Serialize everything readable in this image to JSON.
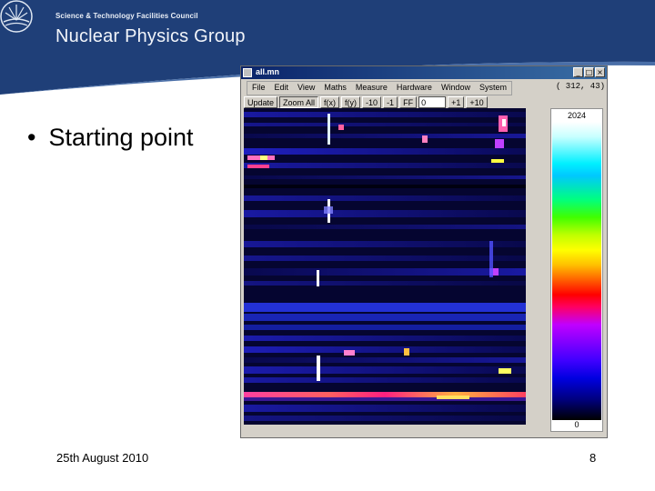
{
  "header": {
    "council": "Science & Technology Facilities Council",
    "group": "Nuclear Physics Group",
    "colors": {
      "band": "#1f3f78",
      "accent": "#4a6fa8"
    }
  },
  "bullet": {
    "dot": "•",
    "text": "Starting point"
  },
  "footer": {
    "date": "25th August 2010",
    "page": "8"
  },
  "window": {
    "title": "all.mn",
    "buttons": [
      "_",
      "□",
      "×"
    ],
    "menu": [
      "File",
      "Edit",
      "View",
      "Maths",
      "Measure",
      "Hardware",
      "Window",
      "System"
    ],
    "coords": "( 312, 43)",
    "toolbar": {
      "update": "Update",
      "zoom": "Zoom All",
      "fx": "f(x)",
      "fy": "f(y)",
      "minus10": "-10",
      "minus1": "-1",
      "ff": "FF",
      "ff_value": "0",
      "plus1": "+1",
      "plus10": "+10"
    },
    "scale": {
      "max": "2024",
      "min": "0"
    }
  }
}
